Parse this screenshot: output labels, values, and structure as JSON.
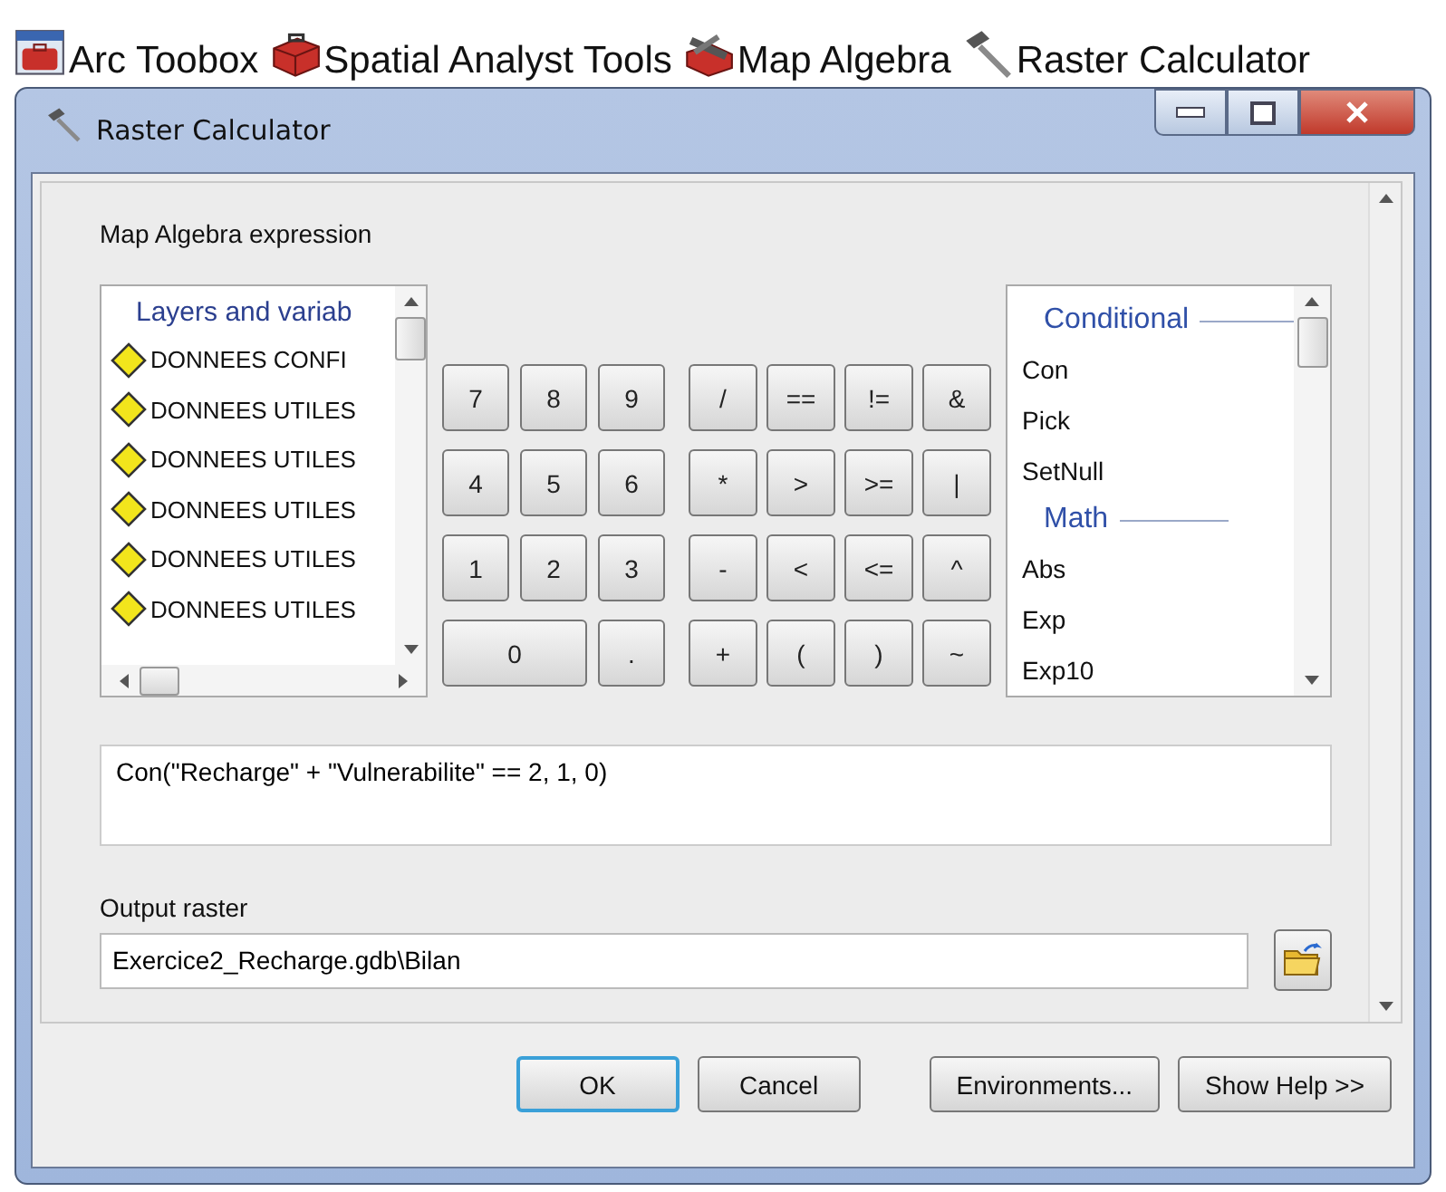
{
  "breadcrumb": [
    {
      "label": "Arc Toobox"
    },
    {
      "label": "Spatial Analyst Tools"
    },
    {
      "label": "Map Algebra"
    },
    {
      "label": "Raster Calculator"
    }
  ],
  "window": {
    "title": "Raster Calculator"
  },
  "expression_label": "Map Algebra expression",
  "layers": {
    "header": "Layers and variab",
    "items": [
      "DONNEES CONFI",
      "DONNEES UTILES",
      "DONNEES UTILES",
      "DONNEES UTILES",
      "DONNEES UTILES",
      "DONNEES UTILES"
    ]
  },
  "keypad": {
    "numbers": [
      [
        {
          "label": "7",
          "kind": "normal"
        },
        {
          "label": "8",
          "kind": "normal"
        },
        {
          "label": "9",
          "kind": "normal"
        }
      ],
      [
        {
          "label": "4",
          "kind": "normal"
        },
        {
          "label": "5",
          "kind": "normal"
        },
        {
          "label": "6",
          "kind": "normal"
        }
      ],
      [
        {
          "label": "1",
          "kind": "normal"
        },
        {
          "label": "2",
          "kind": "normal"
        },
        {
          "label": "3",
          "kind": "normal"
        }
      ],
      [
        {
          "label": "0",
          "kind": "wide"
        },
        {
          "label": ".",
          "kind": "normal"
        }
      ]
    ],
    "operators": [
      [
        {
          "label": "/",
          "kind": "normal"
        },
        {
          "label": "==",
          "kind": "normal"
        },
        {
          "label": "!=",
          "kind": "normal"
        },
        {
          "label": "&",
          "kind": "normal"
        }
      ],
      [
        {
          "label": "*",
          "kind": "normal"
        },
        {
          "label": ">",
          "kind": "normal"
        },
        {
          "label": ">=",
          "kind": "normal"
        },
        {
          "label": "|",
          "kind": "normal"
        }
      ],
      [
        {
          "label": "-",
          "kind": "normal"
        },
        {
          "label": "<",
          "kind": "normal"
        },
        {
          "label": "<=",
          "kind": "normal"
        },
        {
          "label": "^",
          "kind": "normal"
        }
      ],
      [
        {
          "label": "+",
          "kind": "normal"
        },
        {
          "label": "(",
          "kind": "normal"
        },
        {
          "label": ")",
          "kind": "normal"
        },
        {
          "label": "~",
          "kind": "normal"
        }
      ]
    ]
  },
  "functions": [
    {
      "kind": "group",
      "label": "Conditional"
    },
    {
      "kind": "item",
      "label": "Con"
    },
    {
      "kind": "item",
      "label": "Pick"
    },
    {
      "kind": "item",
      "label": "SetNull"
    },
    {
      "kind": "group",
      "label": "Math"
    },
    {
      "kind": "item",
      "label": "Abs"
    },
    {
      "kind": "item",
      "label": "Exp"
    },
    {
      "kind": "item",
      "label": "Exp10"
    }
  ],
  "expression": "Con(\"Recharge\" + \"Vulnerabilite\" == 2, 1, 0)",
  "output": {
    "label": "Output raster",
    "value": "Exercice2_Recharge.gdb\\Bilan"
  },
  "buttons": [
    {
      "label": "OK",
      "default": true
    },
    {
      "label": "Cancel",
      "default": false
    },
    {
      "label": "Environments...",
      "default": false
    },
    {
      "label": "Show Help >>",
      "default": false
    }
  ]
}
